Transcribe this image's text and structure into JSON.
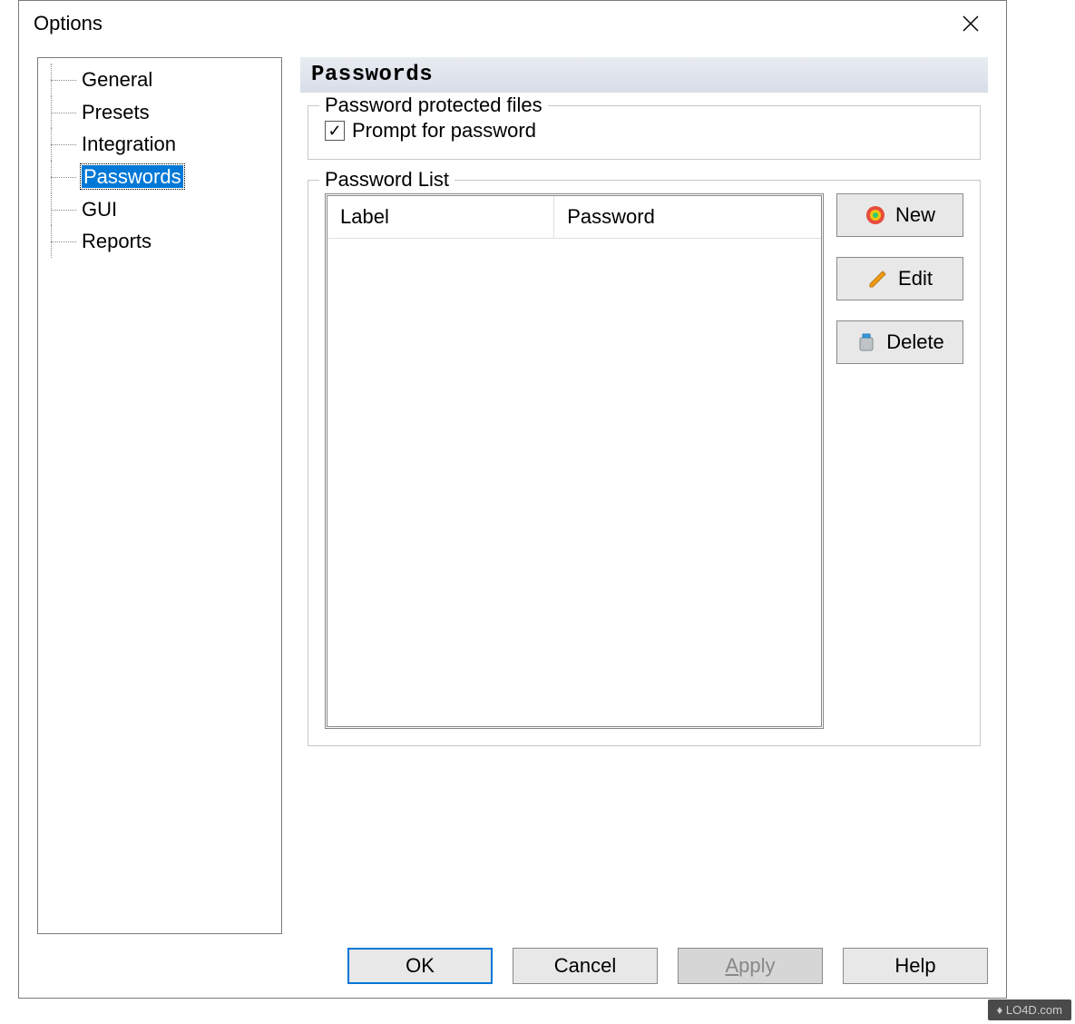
{
  "window": {
    "title": "Options"
  },
  "tree": {
    "items": [
      {
        "label": "General",
        "selected": false
      },
      {
        "label": "Presets",
        "selected": false
      },
      {
        "label": "Integration",
        "selected": false
      },
      {
        "label": "Passwords",
        "selected": true
      },
      {
        "label": "GUI",
        "selected": false
      },
      {
        "label": "Reports",
        "selected": false
      }
    ]
  },
  "panel": {
    "heading": "Passwords",
    "group_protected": {
      "legend": "Password protected files",
      "checkbox_label": "Prompt for password",
      "checked": true
    },
    "group_list": {
      "legend": "Password List",
      "columns": {
        "label": "Label",
        "password": "Password"
      },
      "rows": []
    },
    "buttons": {
      "new": "New",
      "edit": "Edit",
      "delete": "Delete"
    }
  },
  "footer": {
    "ok": "OK",
    "cancel": "Cancel",
    "apply": "Apply",
    "help": "Help"
  },
  "watermark": "LO4D.com"
}
